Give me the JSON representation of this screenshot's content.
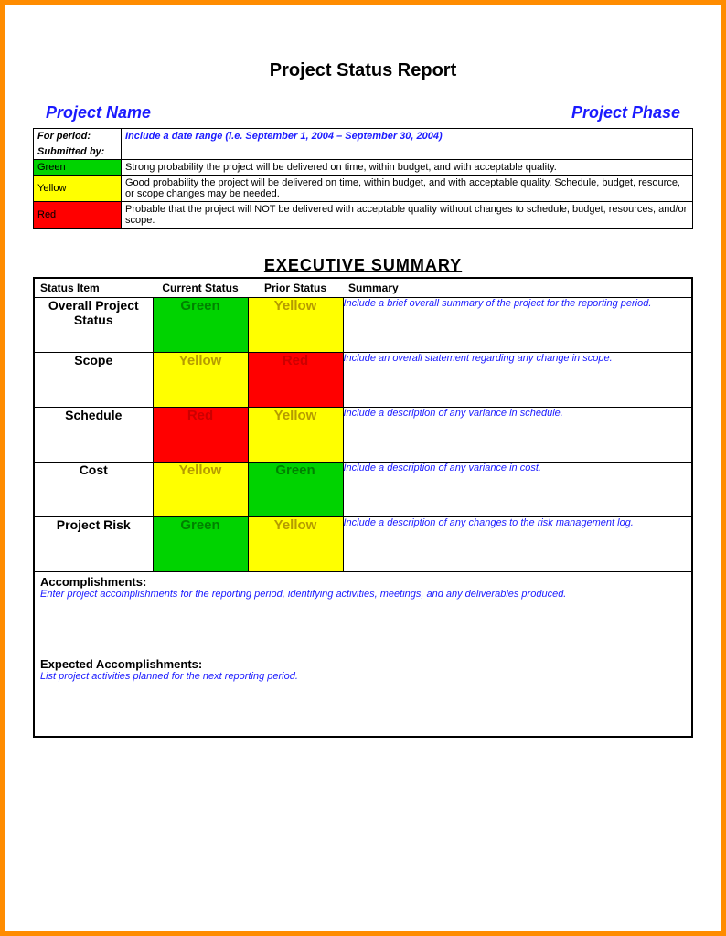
{
  "title": "Project Status Report",
  "headers": {
    "left": "Project Name",
    "right": "Project Phase"
  },
  "meta": {
    "period_label": "For period:",
    "period_value": "Include a date range (i.e. September 1, 2004 – September 30, 2004)",
    "submitted_label": "Submitted by:",
    "submitted_value": ""
  },
  "legend": [
    {
      "color": "green",
      "label": "Green",
      "desc": "Strong probability the project will be delivered on time, within budget, and with acceptable quality."
    },
    {
      "color": "yellow",
      "label": "Yellow",
      "desc": "Good probability the project will be delivered on time, within budget, and with acceptable quality. Schedule, budget, resource, or scope changes may be needed."
    },
    {
      "color": "red",
      "label": "Red",
      "desc": "Probable that the project will NOT be delivered with acceptable quality without changes to schedule, budget, resources, and/or scope."
    }
  ],
  "exec_title": "EXECUTIVE SUMMARY",
  "exec_headers": {
    "item": "Status Item",
    "current": "Current Status",
    "prior": "Prior Status",
    "summary": "Summary"
  },
  "rows": [
    {
      "item": "Overall Project Status",
      "current": "Green",
      "prior": "Yellow",
      "summary": "Include a brief overall summary of the project for the reporting period."
    },
    {
      "item": "Scope",
      "current": "Yellow",
      "prior": "Red",
      "summary": "Include an overall statement regarding any change in scope."
    },
    {
      "item": "Schedule",
      "current": "Red",
      "prior": "Yellow",
      "summary": "Include a description of any variance in schedule."
    },
    {
      "item": "Cost",
      "current": "Yellow",
      "prior": "Green",
      "summary": "Include a description of any variance in cost."
    },
    {
      "item": "Project Risk",
      "current": "Green",
      "prior": "Yellow",
      "summary": "Include a description of any changes to the risk management log."
    }
  ],
  "accomplishments": {
    "label": "Accomplishments:",
    "text": "Enter project accomplishments for the reporting period, identifying activities, meetings, and any deliverables produced."
  },
  "expected": {
    "label": "Expected Accomplishments:",
    "text": "List project activities planned for the next reporting period."
  },
  "color_map": {
    "Green": {
      "bg": "bg-green",
      "txt": "txt-green"
    },
    "Yellow": {
      "bg": "bg-yellow",
      "txt": "txt-yellow"
    },
    "Red": {
      "bg": "bg-red",
      "txt": "txt-red"
    }
  }
}
